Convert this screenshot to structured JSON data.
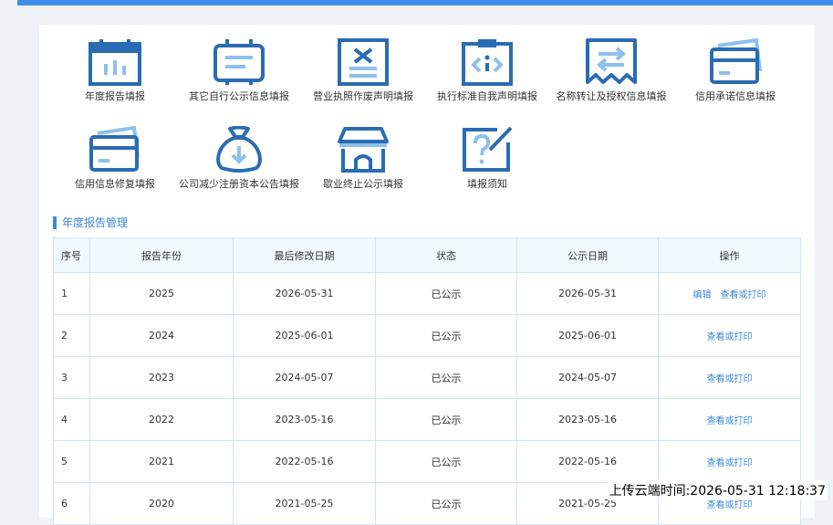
{
  "tiles": [
    {
      "label": "年度报告填报",
      "icon": "calendar-chart-icon"
    },
    {
      "label": "其它自行公示信息填报",
      "icon": "board-lines-icon"
    },
    {
      "label": "营业执照作废声明填报",
      "icon": "cancel-document-icon"
    },
    {
      "label": "执行标准自我声明填报",
      "icon": "clipboard-code-icon"
    },
    {
      "label": "名称转让及授权信息填报",
      "icon": "transfer-arrows-icon"
    },
    {
      "label": "信用承诺信息填报",
      "icon": "credit-card-icon"
    },
    {
      "label": "信用信息修复填报",
      "icon": "card-repair-icon"
    },
    {
      "label": "公司减少注册资本公告填报",
      "icon": "money-bag-down-icon"
    },
    {
      "label": "歇业终止公示填报",
      "icon": "storefront-icon"
    },
    {
      "label": "填报须知",
      "icon": "question-edit-icon"
    }
  ],
  "section_title": "年度报告管理",
  "table": {
    "headers": [
      "序号",
      "报告年份",
      "最后修改日期",
      "状态",
      "公示日期",
      "操作"
    ],
    "rows": [
      {
        "no": "1",
        "year": "2025",
        "modified": "2026-05-31",
        "status": "已公示",
        "published": "2026-05-31",
        "actions": [
          "编辑",
          "查看或打印"
        ]
      },
      {
        "no": "2",
        "year": "2024",
        "modified": "2025-06-01",
        "status": "已公示",
        "published": "2025-06-01",
        "actions": [
          "查看或打印"
        ]
      },
      {
        "no": "3",
        "year": "2023",
        "modified": "2024-05-07",
        "status": "已公示",
        "published": "2024-05-07",
        "actions": [
          "查看或打印"
        ]
      },
      {
        "no": "4",
        "year": "2022",
        "modified": "2023-05-16",
        "status": "已公示",
        "published": "2023-05-16",
        "actions": [
          "查看或打印"
        ]
      },
      {
        "no": "5",
        "year": "2021",
        "modified": "2022-05-16",
        "status": "已公示",
        "published": "2022-05-16",
        "actions": [
          "查看或打印"
        ]
      },
      {
        "no": "6",
        "year": "2020",
        "modified": "2021-05-25",
        "status": "已公示",
        "published": "2021-05-25",
        "actions": [
          "查看或打印"
        ]
      }
    ]
  },
  "upload_time": "上传云端时间:2026-05-31 12:18:37",
  "colors": {
    "accent": "#3a8ad8",
    "icon_dark": "#2a6cb3",
    "icon_light": "#8ec0ee",
    "topbar": "#3f8ee9"
  }
}
